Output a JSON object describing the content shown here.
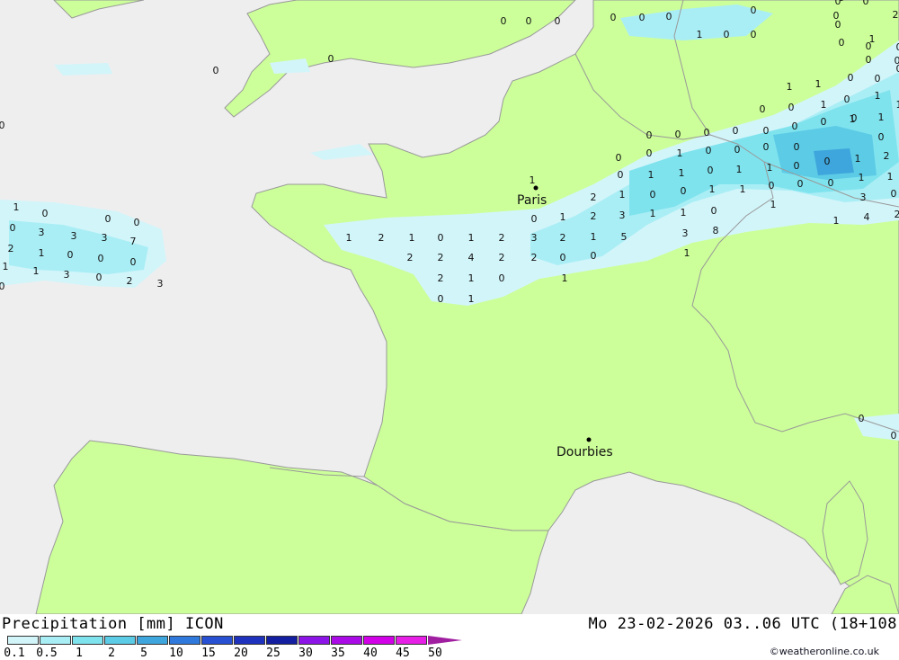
{
  "legend": {
    "title": "Precipitation [mm] ICON",
    "datetime": "Mo 23-02-2026 03..06 UTC (18+108",
    "ticks": [
      "0.1",
      "0.5",
      "1",
      "2",
      "5",
      "10",
      "15",
      "20",
      "25",
      "30",
      "35",
      "40",
      "45",
      "50"
    ],
    "colors": [
      "#d2f5fa",
      "#aaeef5",
      "#7fe3ee",
      "#5ccbe6",
      "#3ea6dc",
      "#3079dc",
      "#2850d2",
      "#1e32be",
      "#141ea0",
      "#8c14e6",
      "#aa0ae6",
      "#d200e6",
      "#e61ee6",
      "#a01ea0"
    ],
    "copyright": "©weatheronline.co.uk"
  },
  "map": {
    "colors": {
      "sea": "#eeeeee",
      "land": "#ccff99",
      "border": "#999999"
    },
    "cities": [
      {
        "name": "Paris"
      },
      {
        "name": "Dourbies"
      }
    ],
    "values": [
      "0",
      "0",
      "0",
      "0",
      "0",
      "0",
      "0",
      "0",
      "0",
      "0",
      "0",
      "0",
      "1",
      "0",
      "0",
      "1",
      "0",
      "0",
      "0",
      "0",
      "1",
      "1",
      "0",
      "0",
      "1",
      "1",
      "0",
      "0",
      "1",
      "0",
      "1",
      "1",
      "1",
      "0",
      "0",
      "0",
      "0",
      "0",
      "0",
      "0",
      "0",
      "0",
      "0",
      "0",
      "1",
      "0",
      "0",
      "0",
      "0",
      "0",
      "0",
      "0",
      "0",
      "0",
      "1",
      "1",
      "0",
      "1",
      "1",
      "0",
      "0",
      "1",
      "2",
      "1",
      "0",
      "0",
      "0",
      "1",
      "1",
      "2",
      "1",
      "0",
      "0",
      "1",
      "1",
      "1",
      "3",
      "0",
      "0",
      "1",
      "2",
      "3",
      "1",
      "1",
      "0",
      "1",
      "4",
      "2",
      "3",
      "3",
      "3",
      "7",
      "1",
      "2",
      "1",
      "0",
      "1",
      "2",
      "3",
      "2",
      "1",
      "5",
      "3",
      "8",
      "2",
      "1",
      "0",
      "0",
      "0",
      "2",
      "2",
      "4",
      "2",
      "2",
      "0",
      "0",
      "1",
      "1",
      "1",
      "3",
      "0",
      "2",
      "3",
      "0",
      "2",
      "1",
      "0",
      "1",
      "0",
      "1",
      "0",
      "0",
      "0",
      "0",
      "1",
      "2",
      "0",
      "0",
      "0",
      "0",
      "0",
      "1",
      "2",
      "4"
    ]
  }
}
